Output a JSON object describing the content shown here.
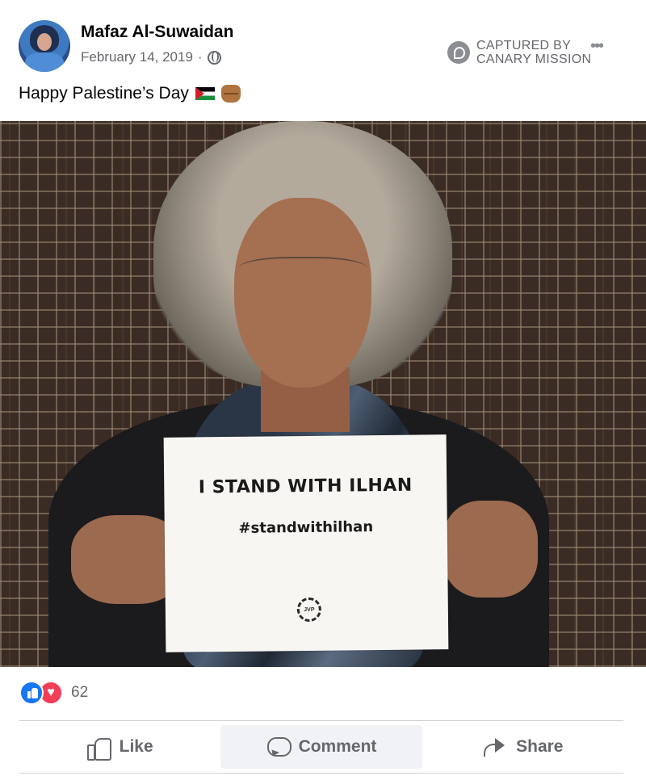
{
  "post": {
    "author_name": "Mafaz Al-Suwaidan",
    "date": "February 14, 2019",
    "separator": "·",
    "privacy_icon": "globe-icon",
    "caption_text": "Happy Palestine’s Day",
    "caption_emojis": [
      "palestine-flag-icon",
      "raised-fist-icon"
    ]
  },
  "watermark": {
    "line1": "CAPTURED BY",
    "line2": "CANARY MISSION",
    "icon": "canary-icon"
  },
  "more_options": "•••",
  "photo": {
    "sign_line1": "I STAND WITH ILHAN",
    "sign_line2": "#standwithilhan",
    "logo_text": "JVP"
  },
  "reactions": {
    "icons": [
      "like-reaction-icon",
      "love-reaction-icon"
    ],
    "count": "62"
  },
  "actions": {
    "like_label": "Like",
    "comment_label": "Comment",
    "share_label": "Share"
  },
  "colors": {
    "facebook_blue": "#1877f2",
    "love_red": "#f33e58",
    "secondary_text": "#65676b",
    "hover_bg": "#f0f2f5"
  }
}
